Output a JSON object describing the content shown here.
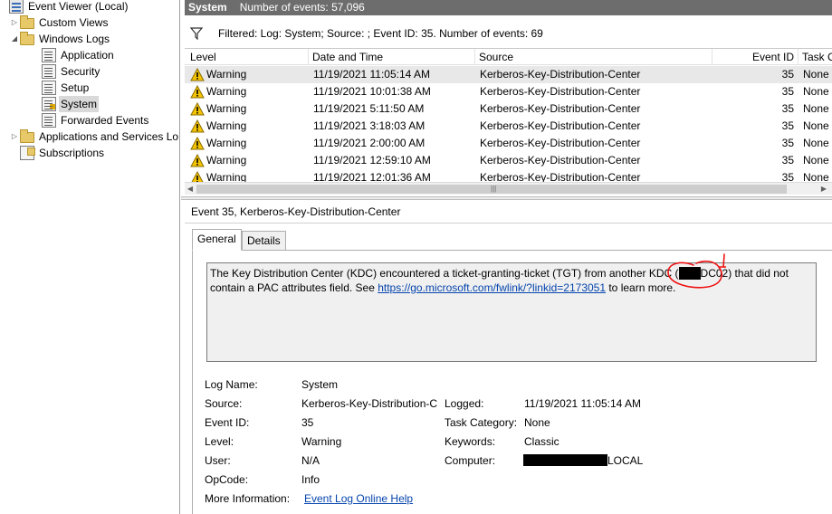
{
  "tree": {
    "root": "Event Viewer (Local)",
    "custom_views": "Custom Views",
    "windows_logs": "Windows Logs",
    "application": "Application",
    "security": "Security",
    "setup": "Setup",
    "system": "System",
    "forwarded": "Forwarded Events",
    "app_services": "Applications and Services Lo",
    "subscriptions": "Subscriptions"
  },
  "header": {
    "title": "System",
    "count": "Number of events: 57,096"
  },
  "filter": {
    "text": "Filtered: Log: System; Source: ; Event ID: 35. Number of events: 69"
  },
  "columns": {
    "level": "Level",
    "datetime": "Date and Time",
    "source": "Source",
    "event_id": "Event ID",
    "task": "Task C"
  },
  "events": [
    {
      "level": "Warning",
      "datetime": "11/19/2021 11:05:14 AM",
      "source": "Kerberos-Key-Distribution-Center",
      "event_id": "35",
      "task": "None"
    },
    {
      "level": "Warning",
      "datetime": "11/19/2021 10:01:38 AM",
      "source": "Kerberos-Key-Distribution-Center",
      "event_id": "35",
      "task": "None"
    },
    {
      "level": "Warning",
      "datetime": "11/19/2021 5:11:50 AM",
      "source": "Kerberos-Key-Distribution-Center",
      "event_id": "35",
      "task": "None"
    },
    {
      "level": "Warning",
      "datetime": "11/19/2021 3:18:03 AM",
      "source": "Kerberos-Key-Distribution-Center",
      "event_id": "35",
      "task": "None"
    },
    {
      "level": "Warning",
      "datetime": "11/19/2021 2:00:00 AM",
      "source": "Kerberos-Key-Distribution-Center",
      "event_id": "35",
      "task": "None"
    },
    {
      "level": "Warning",
      "datetime": "11/19/2021 12:59:10 AM",
      "source": "Kerberos-Key-Distribution-Center",
      "event_id": "35",
      "task": "None"
    },
    {
      "level": "Warning",
      "datetime": "11/19/2021 12:01:36 AM",
      "source": "Kerberos-Key-Distribution-Center",
      "event_id": "35",
      "task": "None"
    }
  ],
  "detail": {
    "title": "Event 35, Kerberos-Key-Distribution-Center",
    "tab_general": "General",
    "tab_details": "Details",
    "message_a": "The Key Distribution Center (KDC) encountered a ticket-granting-ticket (TGT) from another KDC (",
    "message_redacted": "XXX",
    "message_b": "DC02) that did not contain a PAC attributes field. See ",
    "message_link": "https://go.microsoft.com/fwlink/?linkid=2173051",
    "message_c": " to learn more."
  },
  "props": {
    "log_name_label": "Log Name:",
    "log_name": "System",
    "source_label": "Source:",
    "source": "Kerberos-Key-Distribution-C",
    "logged_label": "Logged:",
    "logged": "11/19/2021 11:05:14 AM",
    "event_id_label": "Event ID:",
    "event_id": "35",
    "task_category_label": "Task Category:",
    "task_category": "None",
    "level_label": "Level:",
    "level": "Warning",
    "keywords_label": "Keywords:",
    "keywords": "Classic",
    "user_label": "User:",
    "user": "N/A",
    "computer_label": "Computer:",
    "computer_suffix": "LOCAL",
    "opcode_label": "OpCode:",
    "opcode": "Info",
    "more_info_label": "More Information:",
    "more_info_link": "Event Log Online Help"
  }
}
